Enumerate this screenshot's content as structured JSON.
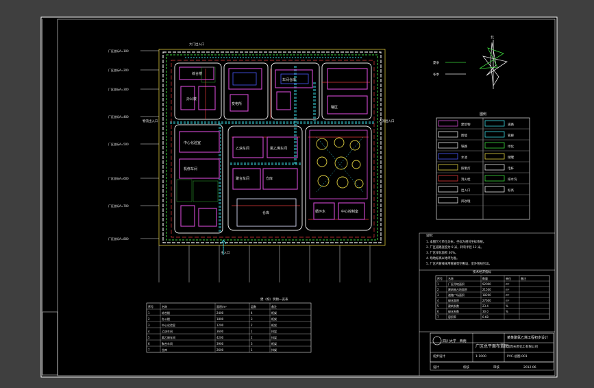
{
  "drawing": {
    "title_cn": "广区总平面布置图",
    "scale": "1:1000",
    "university": "四川大学 · 西南",
    "project": "某某聚氯乙烯工程初步设计",
    "company": "宜宾天原化工有限公司",
    "sheet_no": "PVC-总图-001"
  },
  "legend": {
    "title": "图例",
    "items": [
      "建筑物",
      "道路",
      "围墙",
      "管廊",
      "铁路",
      "绿化",
      "水池",
      "储罐",
      "照明灯",
      "电杆",
      "消火栓",
      "排水沟",
      "出入口",
      "标高",
      "风玫瑰"
    ]
  },
  "wind": {
    "north": "北",
    "summer": "夏季",
    "winter": "冬季"
  },
  "gates": {
    "left": "物流出入口",
    "right": "人流出入口",
    "bottom": "主入口",
    "top": "大门出入口"
  },
  "notes": {
    "title": "说明：",
    "lines": [
      "1. 本图尺寸单位为米，坐标为相对坐标系统。",
      "2. 厂区道路宽度为 9 米，转弯半径 12 米。",
      "3. 厂区绿化面积 30%。",
      "4. 场地标高以地坪为准。",
      "5. 厂区内管线采用管廊架空敷设，室外管线另详。"
    ]
  },
  "buildings": [
    {
      "label": "综合楼",
      "sub": "(A)"
    },
    {
      "label": "办公楼",
      "sub": ""
    },
    {
      "label": "车间仓库",
      "sub": ""
    },
    {
      "label": "变电所",
      "sub": ""
    },
    {
      "label": "中心化验室",
      "sub": "(B)"
    },
    {
      "label": "机修车间",
      "sub": ""
    },
    {
      "label": "乙炔车间",
      "sub": "(C)"
    },
    {
      "label": "氯乙烯车间",
      "sub": "(D)"
    },
    {
      "label": "聚合车间",
      "sub": "(E)"
    },
    {
      "label": "仓库",
      "sub": "(F)"
    },
    {
      "label": "罐区",
      "sub": ""
    },
    {
      "label": "循环水",
      "sub": ""
    },
    {
      "label": "中心控制室",
      "sub": ""
    }
  ],
  "coord_labels": [
    "厂区坐标A=100",
    "厂区坐标A=200",
    "厂区坐标A=300",
    "厂区坐标A=400",
    "厂区坐标A=500",
    "厂区坐标A=600",
    "厂区坐标A=700",
    "厂区坐标A=800"
  ],
  "econ_table": {
    "title": "技术经济指标",
    "headers": [
      "序号",
      "名称",
      "数量",
      "单位",
      "备注"
    ],
    "rows": [
      [
        "1",
        "厂区用地面积",
        "92000",
        "m²",
        ""
      ],
      [
        "2",
        "建筑物占地面积",
        "21500",
        "m²",
        ""
      ],
      [
        "3",
        "道路广场面积",
        "18200",
        "m²",
        ""
      ],
      [
        "4",
        "绿化面积",
        "27600",
        "m²",
        ""
      ],
      [
        "5",
        "建筑系数",
        "23.4",
        "%",
        ""
      ],
      [
        "6",
        "绿化系数",
        "30.0",
        "%",
        ""
      ],
      [
        "7",
        "容积率",
        "0.68",
        "",
        ""
      ]
    ]
  },
  "building_table": {
    "title": "建（构）筑物一览表",
    "headers": [
      "序号",
      "名称",
      "面积/m²",
      "层数",
      "备注"
    ],
    "rows": [
      [
        "1",
        "综合楼",
        "2400",
        "4",
        "框架"
      ],
      [
        "2",
        "办公楼",
        "1800",
        "3",
        "框架"
      ],
      [
        "3",
        "中心化验室",
        "1200",
        "2",
        "框架"
      ],
      [
        "4",
        "乙炔车间",
        "3600",
        "1",
        "排架"
      ],
      [
        "5",
        "氯乙烯车间",
        "4200",
        "2",
        "排架"
      ],
      [
        "6",
        "聚合车间",
        "3900",
        "3",
        "框架"
      ],
      [
        "7",
        "仓库",
        "2600",
        "1",
        "排架"
      ]
    ]
  },
  "title_block": {
    "rows": [
      "设计",
      "校核",
      "审核",
      "审定"
    ],
    "right_top": "设计阶段",
    "right_mid": "初步设计",
    "date": "2012.06"
  }
}
